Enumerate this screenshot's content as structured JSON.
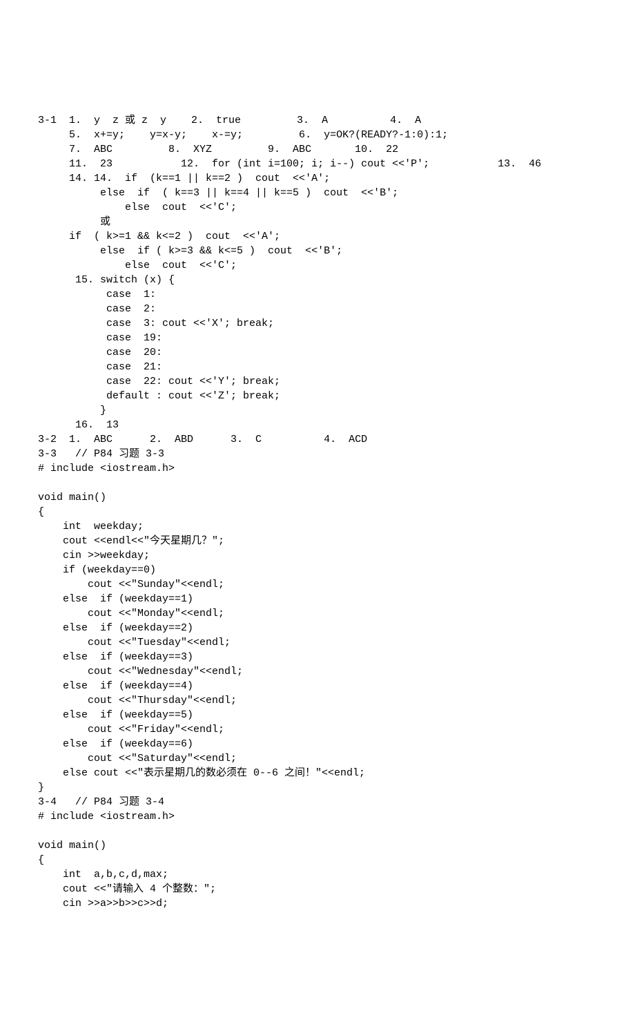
{
  "lines": [
    "3-1  1.  y  z 或 z  y    2.  true         3.  A          4.  A",
    "     5.  x+=y;    y=x-y;    x-=y;         6.  y=OK?(READY?-1:0):1;",
    "     7.  ABC         8.  XYZ         9.  ABC       10.  22",
    "     11.  23           12.  for (int i=100; i; i--) cout <<'P';           13.  46 ",
    "     14. 14.  if  (k==1 || k==2 )  cout  <<'A';",
    "          else  if  ( k==3 || k==4 || k==5 )  cout  <<'B';",
    "              else  cout  <<'C';",
    "          或",
    "     if  ( k>=1 && k<=2 )  cout  <<'A';",
    "          else  if ( k>=3 && k<=5 )  cout  <<'B';",
    "              else  cout  <<'C';",
    "      15. switch (x) {",
    "           case  1:",
    "           case  2:",
    "           case  3: cout <<'X'; break;",
    "           case  19:",
    "           case  20:",
    "           case  21:",
    "           case  22: cout <<'Y'; break;",
    "           default : cout <<'Z'; break;",
    "          }",
    "      16.  13",
    "3-2  1.  ABC      2.  ABD      3.  C          4.  ACD",
    "3-3   // P84 习题 3-3",
    "# include <iostream.h>",
    "",
    "void main()",
    "{",
    "    int  weekday;",
    "    cout <<endl<<\"今天星期几？\";",
    "    cin >>weekday;",
    "    if (weekday==0)",
    "        cout <<\"Sunday\"<<endl;",
    "    else  if (weekday==1)",
    "        cout <<\"Monday\"<<endl;",
    "    else  if (weekday==2)",
    "        cout <<\"Tuesday\"<<endl;",
    "    else  if (weekday==3)",
    "        cout <<\"Wednesday\"<<endl;",
    "    else  if (weekday==4)",
    "        cout <<\"Thursday\"<<endl;",
    "    else  if (weekday==5)",
    "        cout <<\"Friday\"<<endl;",
    "    else  if (weekday==6)",
    "        cout <<\"Saturday\"<<endl;",
    "    else cout <<\"表示星期几的数必须在 0--6 之间！\"<<endl;",
    "}",
    "3-4   // P84 习题 3-4",
    "# include <iostream.h>",
    "",
    "void main()",
    "{",
    "    int  a,b,c,d,max;",
    "    cout <<\"请输入 4 个整数：\";",
    "    cin >>a>>b>>c>>d;"
  ]
}
